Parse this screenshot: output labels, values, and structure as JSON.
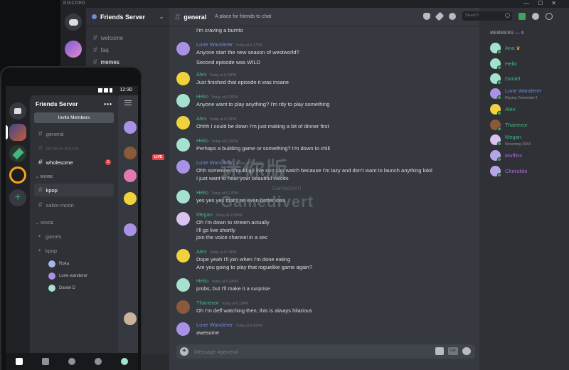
{
  "desktop": {
    "app_title": "DISCORD",
    "window_controls": [
      "—",
      "☐",
      "✕"
    ],
    "server_name": "Friends Server",
    "channels": [
      "welcome",
      "faq",
      "memes"
    ],
    "live_badge": "LIVE",
    "channel_name": "general",
    "channel_topic": "A place for friends to chat",
    "search_placeholder": "Search",
    "composer_placeholder": "Message #general",
    "gif_label": "GIF",
    "members_header": "MEMBERS — 9",
    "members": [
      {
        "name": "Ana",
        "color": "#43b581",
        "crown": "♛",
        "sub": ""
      },
      {
        "name": "Helio",
        "color": "#43b581",
        "sub": ""
      },
      {
        "name": "Daniel",
        "color": "#43b581",
        "sub": ""
      },
      {
        "name": "Lone Wanderer",
        "color": "#7289da",
        "sub": "Playing Vermintide 2"
      },
      {
        "name": "Alex",
        "color": "#43b581",
        "sub": ""
      },
      {
        "name": "Thanexor",
        "color": "#43b581",
        "sub": ""
      },
      {
        "name": "Megan",
        "color": "#43b581",
        "sub": "Streaming 20XX"
      },
      {
        "name": "Muffins",
        "color": "#b06be0",
        "sub": ""
      },
      {
        "name": "Cherukiki",
        "color": "#b06be0",
        "sub": ""
      }
    ],
    "messages": [
      {
        "type": "cont",
        "text": "I'm craving a burrito"
      },
      {
        "author": "Lone Wanderer",
        "color": "#7289da",
        "time": "Today at 6:17PM",
        "lines": [
          "Anyone start the new season of westworld?"
        ]
      },
      {
        "type": "cont",
        "text": "Second episode was WILD"
      },
      {
        "author": "Alex",
        "color": "#43b581",
        "time": "Today at 6:16PM",
        "lines": [
          "Just finished that episode it was insane"
        ]
      },
      {
        "author": "Helio",
        "color": "#43b581",
        "time": "Today at 6:15PM",
        "lines": [
          "Anyone want to play anything? I'm rdy to play something"
        ]
      },
      {
        "author": "Alex",
        "color": "#43b581",
        "time": "Today at 6:16PM",
        "lines": [
          "Ohhh I could be down I'm just making a bit of dinner first"
        ]
      },
      {
        "author": "Helio",
        "color": "#43b581",
        "time": "Today at 6:16PM",
        "lines": [
          "Perhaps a building game or something? I'm down to chill"
        ]
      },
      {
        "author": "Lone Wanderer",
        "color": "#7289da",
        "time": "Today at 6:17PM",
        "lines": [
          "Ohh someone should go live so I can watch because I'm lazy and don't want to launch anything lolol",
          "I just want to hear your beautiful voices"
        ]
      },
      {
        "author": "Helio",
        "color": "#43b581",
        "time": "Today at 6:17PM",
        "lines": [
          "yes yes yes that's an even better idea"
        ]
      },
      {
        "author": "Megan",
        "color": "#43b581",
        "time": "Today at 6:18PM",
        "lines": [
          "Oh I'm down to stream actually",
          "I'll go live shortly",
          "join the voice channel in a sec"
        ]
      },
      {
        "author": "Alex",
        "color": "#43b581",
        "time": "Today at 6:19PM",
        "lines": [
          "Dope yeah I'll join when I'm done eating",
          "Are you going to play that roguelike game again?"
        ]
      },
      {
        "author": "Helio",
        "color": "#43b581",
        "time": "Today at 6:19PM",
        "lines": [
          "probs, but I'll make it a surprise"
        ]
      },
      {
        "author": "Thanexor",
        "color": "#43b581",
        "time": "Today at 6:19PM",
        "lines": [
          "Oh I'm deff watching then, this is always hilarious"
        ]
      },
      {
        "author": "Lone Wanderer",
        "color": "#7289da",
        "time": "Today at 6:20PM",
        "lines": [
          "awesome"
        ]
      }
    ]
  },
  "watermark": {
    "cn": "迷你版",
    "small": "Gamedivert",
    "en": "Gamedivert"
  },
  "phone": {
    "clock": "12:30",
    "server_name": "Friends Server",
    "more": "•••",
    "invite_label": "Invite Members",
    "text_channels": [
      {
        "name": "general",
        "style": "normal"
      },
      {
        "name": "terrace-house",
        "style": "muted"
      },
      {
        "name": "wholesome",
        "style": "bold",
        "badge": "1"
      }
    ],
    "category_more": "MORE",
    "more_channels": [
      {
        "name": "kpop",
        "style": "selected"
      },
      {
        "name": "sailor-moon",
        "style": "normal"
      }
    ],
    "category_voice": "VOICE",
    "voice_channels": [
      "games",
      "kpop"
    ],
    "voice_users": [
      "Roka",
      "Lone wanderer",
      "Daniel D"
    ]
  }
}
